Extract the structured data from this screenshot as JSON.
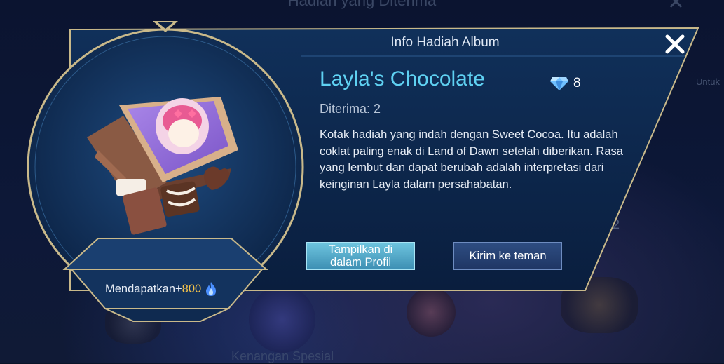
{
  "background": {
    "title": "Hadiah yang Diterima",
    "bottom_text": "Kenangan Spesial",
    "side_text": "Untuk",
    "number": "2"
  },
  "dialog": {
    "header": "Info Hadiah Album",
    "item_name": "Layla's Chocolate",
    "price": "8",
    "price_icon": "diamond-icon",
    "received_label": "Diterima: 2",
    "description": "Kotak hadiah yang indah dengan Sweet Cocoa. Itu adalah coklat paling enak di Land of Dawn setelah diberikan. Rasa yang lembut dan dapat berubah adalah interpretasi dari keinginan Layla dalam persahabatan.",
    "buttons": {
      "profile_line1": "Tampilkan di",
      "profile_line2": "dalam Profil",
      "send": "Kirim ke teman"
    },
    "reward": {
      "label": "Mendapatkan+",
      "value": "800",
      "icon": "flame-icon"
    },
    "colors": {
      "title": "#5fd1f2",
      "reward_value": "#f3c24a",
      "panel_border": "#c9b98a",
      "primary_button": "#4fa7c8"
    }
  }
}
